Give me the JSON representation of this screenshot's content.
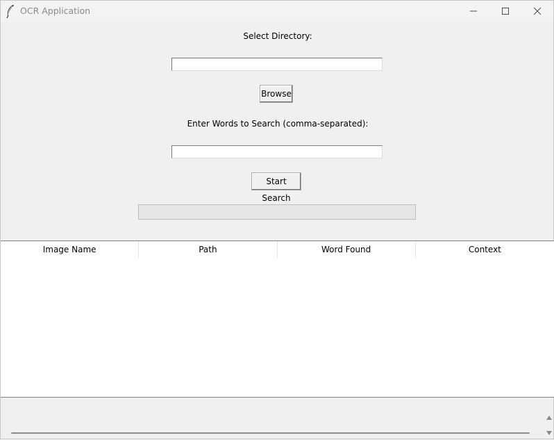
{
  "window": {
    "title": "OCR Application"
  },
  "form": {
    "directory_label": "Select Directory:",
    "directory_value": "",
    "browse_label": "Browse",
    "words_label": "Enter Words to Search (comma-separated):",
    "words_value": "",
    "start_label": "Start Search"
  },
  "progress": {
    "value_percent": 0
  },
  "results": {
    "columns": [
      "Image Name",
      "Path",
      "Word Found",
      "Context"
    ],
    "rows": []
  },
  "icons": {
    "app": "feather-icon",
    "minimize": "minimize-icon",
    "maximize": "maximize-icon",
    "close": "close-icon",
    "scroll_up": "scroll-up-arrow-icon",
    "scroll_down": "scroll-down-arrow-icon"
  }
}
